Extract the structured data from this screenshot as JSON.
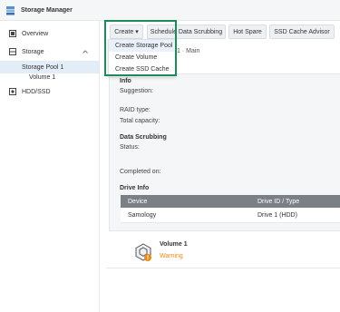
{
  "window": {
    "title": "Storage Manager"
  },
  "sidebar": {
    "items": [
      {
        "label": "Overview",
        "icon": "overview-icon"
      },
      {
        "label": "Storage",
        "icon": "storage-icon"
      },
      {
        "label": "Storage Pool 1"
      },
      {
        "label": "Volume 1"
      },
      {
        "label": "HDD/SSD",
        "icon": "hdd-icon"
      }
    ]
  },
  "toolbar": {
    "create": "Create",
    "schedule": "Schedule Data Scrubbing",
    "hot_spare": "Hot Spare",
    "ssd_cache_advisor": "SSD Cache Advisor"
  },
  "create_menu": {
    "items": [
      "Create Storage Pool",
      "Create Volume",
      "Create SSD Cache"
    ]
  },
  "pool": {
    "title_suffix": "1 · Main",
    "info_heading": "Info",
    "suggestion_label": "Suggestion:",
    "raid_label": "RAID type:",
    "capacity_label": "Total capacity:",
    "scrub_heading": "Data Scrubbing",
    "status_label": "Status:",
    "completed_label": "Completed on:",
    "drive_heading": "Drive Info",
    "drive_columns": [
      "Device",
      "Drive ID / Type"
    ],
    "drive_rows": [
      {
        "device": "Samology",
        "id": "Drive 1 (HDD)"
      }
    ]
  },
  "volume": {
    "title": "Volume 1",
    "status": "Warning"
  },
  "colors": {
    "accent": "#1d8a5a",
    "warning": "#e88b18",
    "selected": "#e2edf8"
  }
}
